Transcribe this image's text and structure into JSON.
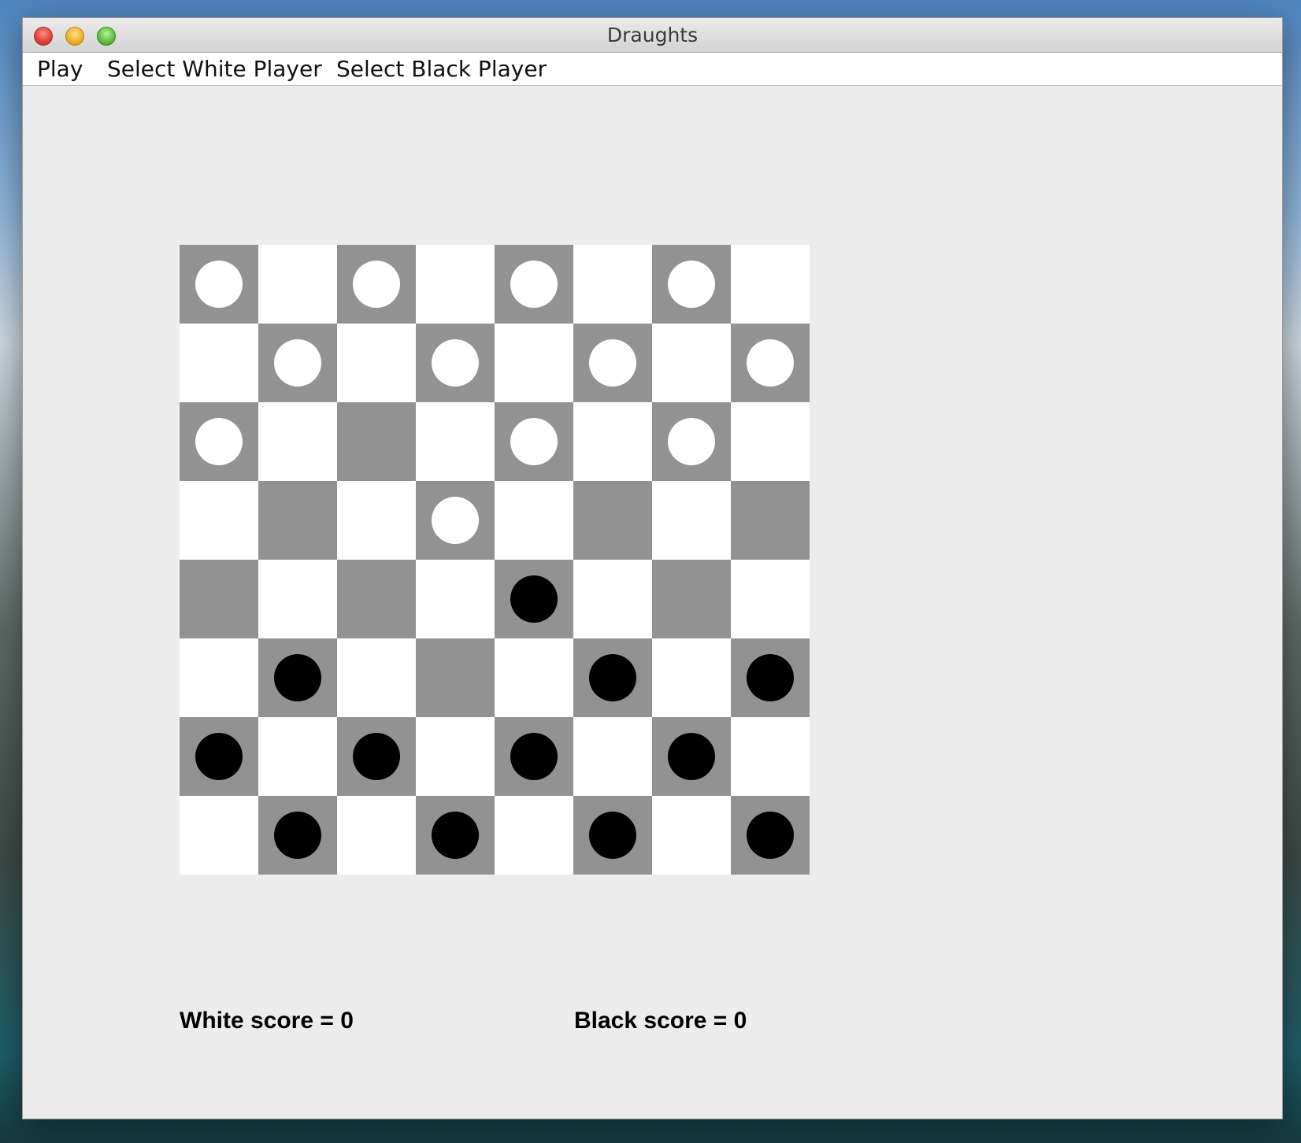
{
  "window": {
    "title": "Draughts"
  },
  "menu": [
    "Play",
    "Select White Player",
    "Select Black Player"
  ],
  "colors": {
    "dark_square": "#929292",
    "light_square": "#ffffff",
    "white_piece": "#ffffff",
    "black_piece": "#000000"
  },
  "board": {
    "rows": [
      "w.w.w.w.",
      ".w.w.w.w",
      "w...w.w.",
      "...w....",
      "....b...",
      ".b...b.b",
      "b.b.b.b.",
      ".b.b.b.b"
    ]
  },
  "scores": {
    "white": "White score = 0",
    "black": "Black score = 0"
  }
}
